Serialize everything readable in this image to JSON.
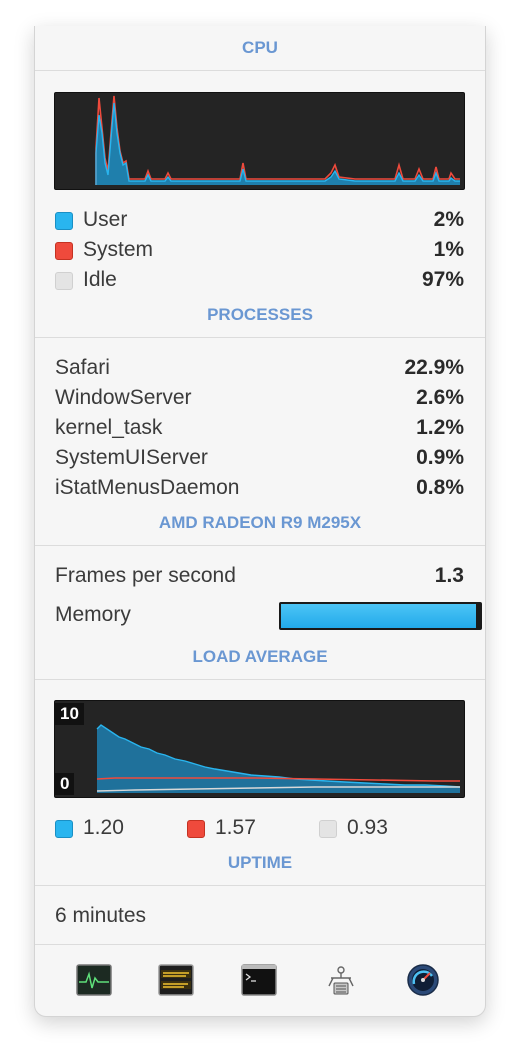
{
  "cpu": {
    "header": "CPU",
    "legend": [
      {
        "label": "User",
        "value": "2%"
      },
      {
        "label": "System",
        "value": "1%"
      },
      {
        "label": "Idle",
        "value": "97%"
      }
    ],
    "colors": {
      "user": "#29b5ef",
      "system": "#ef4a3c",
      "idle": "#e4e4e4"
    }
  },
  "processes": {
    "header": "PROCESSES",
    "items": [
      {
        "name": "Safari",
        "value": "22.9%"
      },
      {
        "name": "WindowServer",
        "value": "2.6%"
      },
      {
        "name": "kernel_task",
        "value": "1.2%"
      },
      {
        "name": "SystemUIServer",
        "value": "0.9%"
      },
      {
        "name": "iStatMenusDaemon",
        "value": "0.8%"
      }
    ]
  },
  "gpu": {
    "header": "AMD RADEON R9 M295X",
    "fps_label": "Frames per second",
    "fps_value": "1.3",
    "memory_label": "Memory",
    "memory_fraction": 0.98
  },
  "load": {
    "header": "LOAD AVERAGE",
    "axis_max": "10",
    "axis_min": "0",
    "values": [
      "1.20",
      "1.57",
      "0.93"
    ]
  },
  "uptime": {
    "header": "UPTIME",
    "value": "6 minutes"
  },
  "footer_icons": [
    "activity-monitor-icon",
    "console-icon",
    "terminal-icon",
    "system-information-icon",
    "disk-utility-icon"
  ]
}
